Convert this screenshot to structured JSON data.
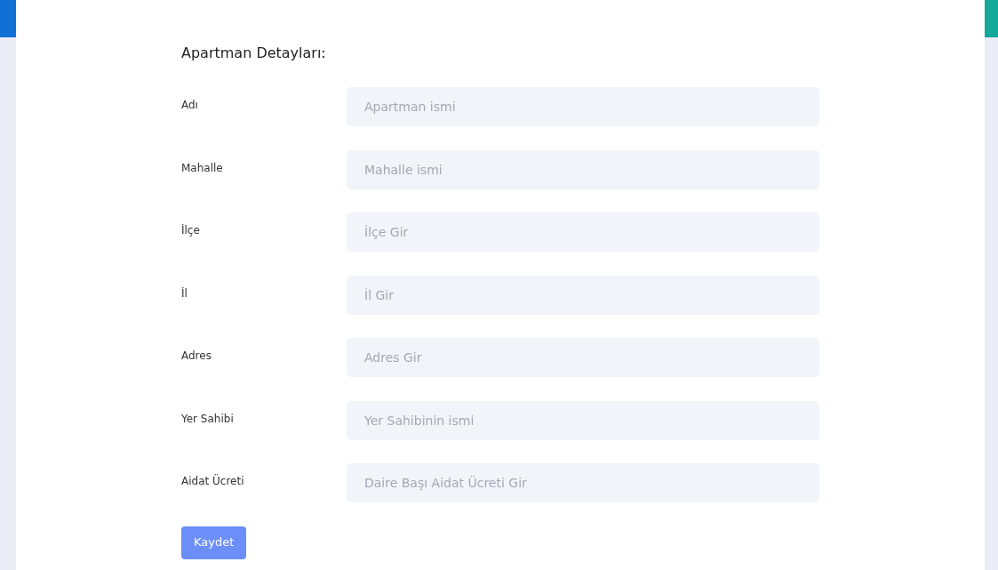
{
  "form": {
    "title": "Apartman Detayları:",
    "fields": [
      {
        "label": "Adı",
        "placeholder": "Apartman ismi"
      },
      {
        "label": "Mahalle",
        "placeholder": "Mahalle ismi"
      },
      {
        "label": "İlçe",
        "placeholder": "İlçe Gir"
      },
      {
        "label": "İl",
        "placeholder": "İl Gir"
      },
      {
        "label": "Adres",
        "placeholder": "Adres Gir"
      },
      {
        "label": "Yer Sahibi",
        "placeholder": "Yer Sahibinin ismi"
      },
      {
        "label": "Aidat Ücreti",
        "placeholder": "Daire Başı Aidat Ücreti Gir"
      }
    ],
    "submit": "Kaydet"
  }
}
